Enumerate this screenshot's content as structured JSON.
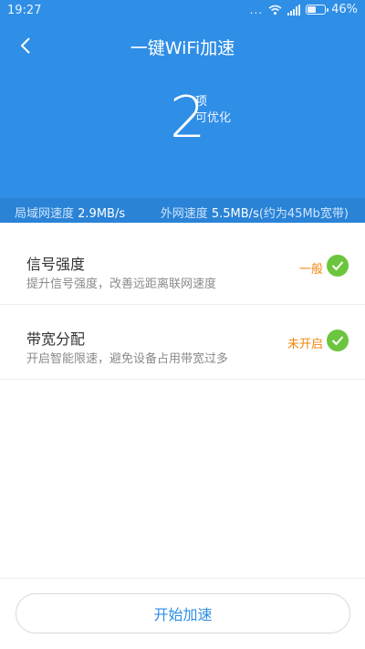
{
  "colors": {
    "header_bg": "#2f8ee6",
    "speedbar_bg": "#2a83d6",
    "status_orange": "#f0850f",
    "check_green": "#6cc53e"
  },
  "statusbar": {
    "time": "19:27",
    "dots": "...",
    "battery": "46%",
    "icons": [
      "wifi-icon",
      "signal-icon",
      "battery-icon"
    ]
  },
  "header": {
    "back_icon": "back-arrow-icon",
    "title": "一键WiFi加速"
  },
  "optimize": {
    "count": "2",
    "unit": "项",
    "label": "可优化"
  },
  "speeds": {
    "lan_label": "局域网速度",
    "lan_value": "2.9MB/s",
    "wan_label": "外网速度",
    "wan_value": "5.5MB/s",
    "wan_note": "(约为45Mb宽带)"
  },
  "items": [
    {
      "name": "信号强度",
      "desc": "提升信号强度，改善远距离联网速度",
      "status": "一般"
    },
    {
      "name": "带宽分配",
      "desc": "开启智能限速，避免设备占用带宽过多",
      "status": "未开启"
    }
  ],
  "footer": {
    "button_label": "开始加速"
  }
}
